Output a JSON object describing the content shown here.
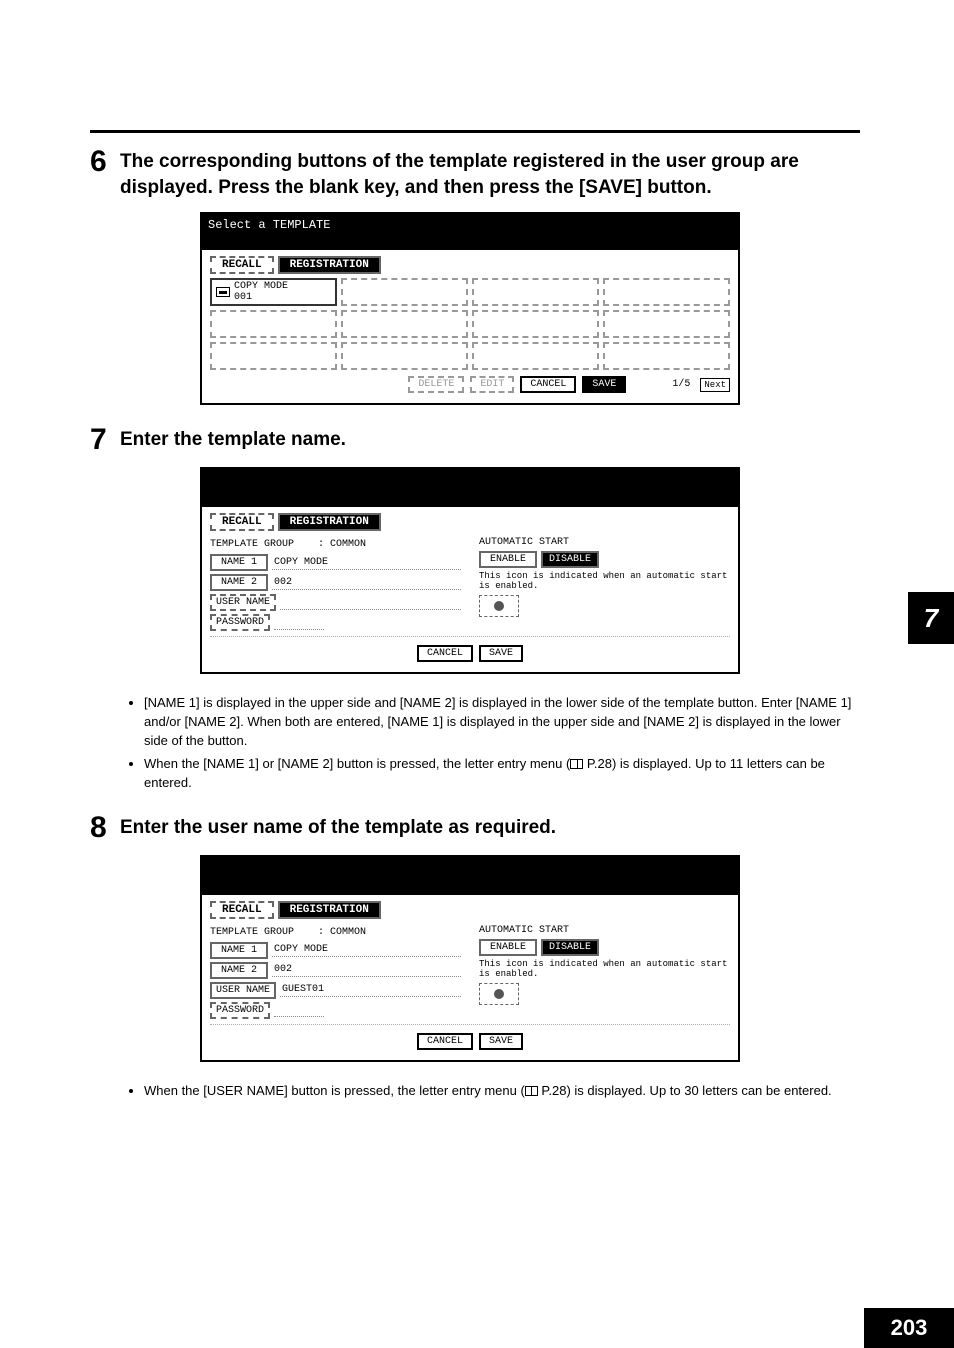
{
  "page_number": "203",
  "side_tab": "7",
  "step6": {
    "num": "6",
    "title": "The corresponding buttons of the template registered in the user group are displayed. Press the blank key, and then press the [SAVE] button.",
    "scr_title": "Select a TEMPLATE",
    "tab_recall": "RECALL",
    "tab_reg": "REGISTRATION",
    "slot_name1": "COPY MODE",
    "slot_name2": "001",
    "btn_delete": "DELETE",
    "btn_edit": "EDIT",
    "btn_cancel": "CANCEL",
    "btn_save": "SAVE",
    "page_ind": "1/5",
    "btn_next": "Next"
  },
  "step7": {
    "num": "7",
    "title": "Enter the template name.",
    "tab_recall": "RECALL",
    "tab_reg": "REGISTRATION",
    "group_label": "TEMPLATE GROUP",
    "group_value": "COMMON",
    "name1_label": "NAME 1",
    "name1_value": "COPY MODE",
    "name2_label": "NAME 2",
    "name2_value": "002",
    "username_label": "USER NAME",
    "username_value": "",
    "password_label": "PASSWORD",
    "auto_label": "AUTOMATIC START",
    "enable": "ENABLE",
    "disable": "DISABLE",
    "auto_note": "This icon is indicated when an automatic start is enabled.",
    "btn_cancel": "CANCEL",
    "btn_save": "SAVE",
    "bullet1": "[NAME 1] is displayed in the upper side and [NAME 2] is displayed in the lower side of the template button. Enter [NAME 1] and/or [NAME 2]. When both are entered, [NAME 1] is displayed in the upper side and [NAME 2] is displayed in the lower side of the button.",
    "bullet2a": "When the [NAME 1] or [NAME 2] button is pressed, the letter entry menu (",
    "bullet2b": " P.28) is displayed. Up to 11 letters can be entered."
  },
  "step8": {
    "num": "8",
    "title": "Enter the user name of the template as required.",
    "tab_recall": "RECALL",
    "tab_reg": "REGISTRATION",
    "group_label": "TEMPLATE GROUP",
    "group_value": "COMMON",
    "name1_label": "NAME 1",
    "name1_value": "COPY MODE",
    "name2_label": "NAME 2",
    "name2_value": "002",
    "username_label": "USER NAME",
    "username_value": "GUEST01",
    "password_label": "PASSWORD",
    "auto_label": "AUTOMATIC START",
    "enable": "ENABLE",
    "disable": "DISABLE",
    "auto_note": "This icon is indicated when an automatic start is enabled.",
    "btn_cancel": "CANCEL",
    "btn_save": "SAVE",
    "bullet1a": "When the [USER NAME] button is pressed, the letter entry menu (",
    "bullet1b": " P.28) is displayed. Up to 30 letters can be entered."
  }
}
